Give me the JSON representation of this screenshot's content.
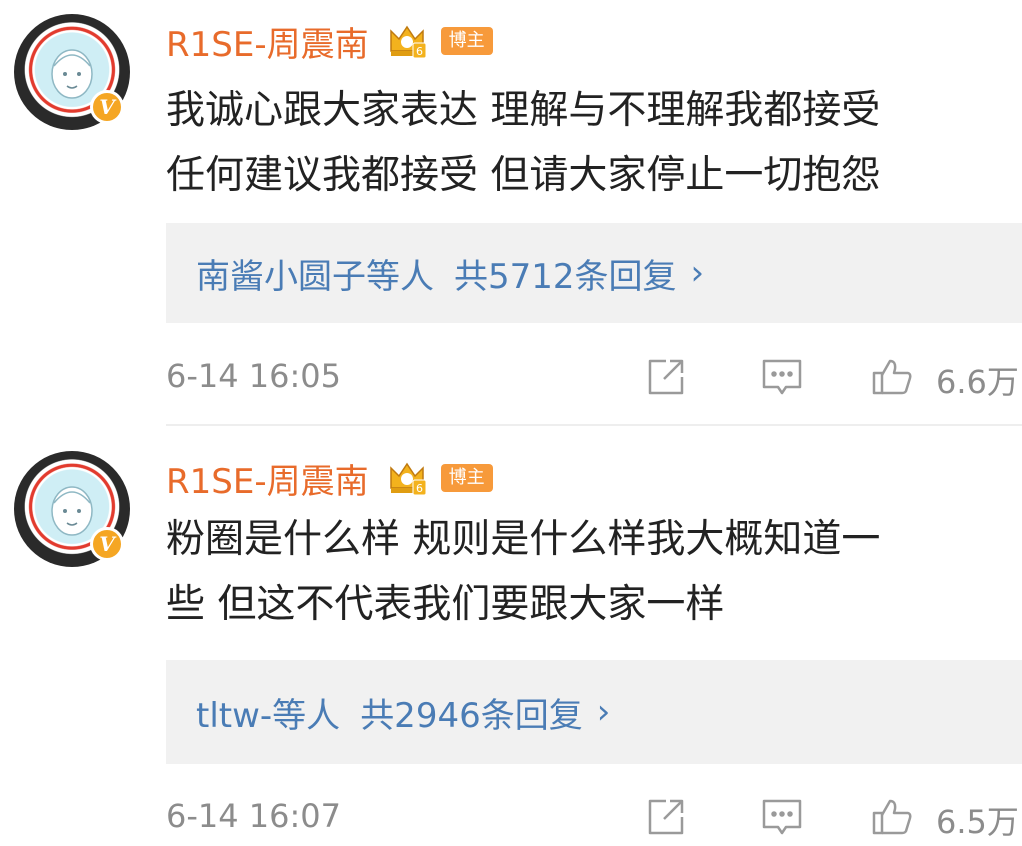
{
  "comments": [
    {
      "username": "R1SE-周震南",
      "badge": "博主",
      "text_line1": "我诚心跟大家表达 理解与不理解我都接受",
      "text_line2": "任何建议我都接受 但请大家停止一切抱怨",
      "reply_users": "南酱小圆子等人",
      "reply_count": "共5712条回复",
      "reply_chevron": "›",
      "time": "6-14 16:05",
      "likes": "6.6万",
      "verified_mark": "V",
      "crown_level": "6"
    },
    {
      "username": "R1SE-周震南",
      "badge": "博主",
      "text_line1": "粉圈是什么样 规则是什么样我大概知道一",
      "text_line2": "些 但这不代表我们要跟大家一样",
      "reply_users": "tltw-等人",
      "reply_count": "共2946条回复",
      "reply_chevron": "›",
      "time": "6-14 16:07",
      "likes": "6.5万",
      "verified_mark": "V",
      "crown_level": "6"
    }
  ],
  "colors": {
    "username": "#e86b2b",
    "badge_bg": "#f79a3b",
    "reply_link": "#4a7cb5",
    "meta": "#8c8c8c",
    "reply_box_bg": "#f1f1f1"
  },
  "icons": {
    "share": "share-icon",
    "reply": "comment-icon",
    "like": "thumbs-up-icon",
    "crown": "crown-icon",
    "verified": "verified-badge-icon"
  }
}
